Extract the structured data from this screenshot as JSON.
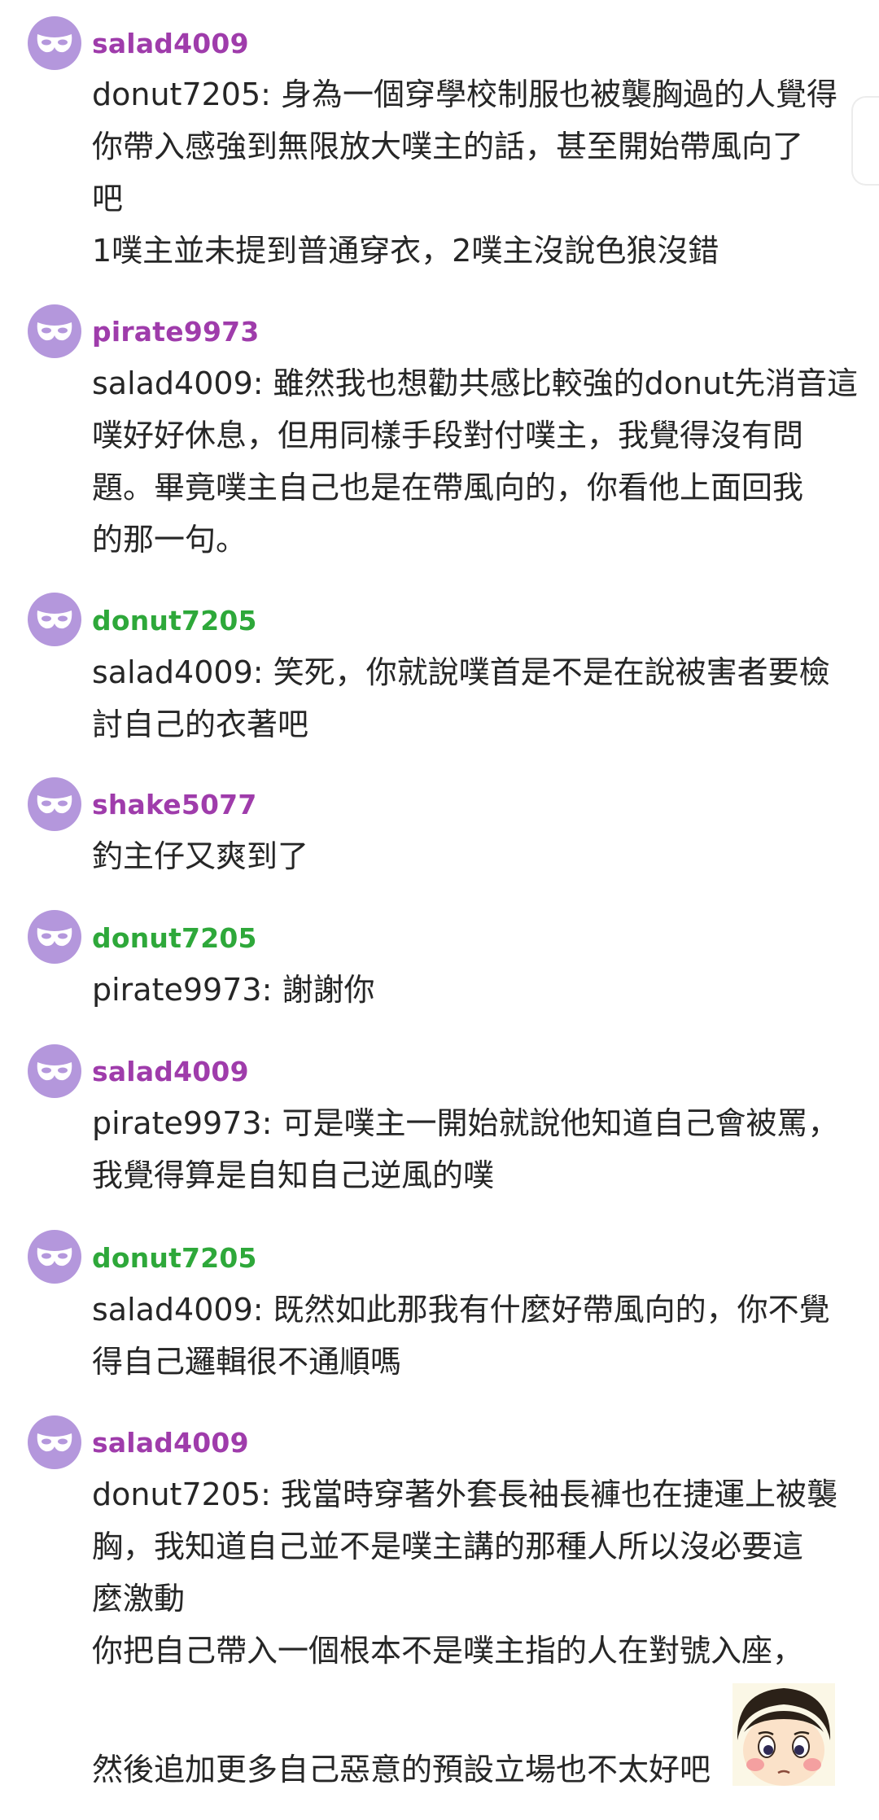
{
  "replies": [
    {
      "username": "salad4009",
      "lines": [
        "donut7205: 身為一個穿學校制服也被襲胸過的人覺得",
        "你帶入感強到無限放大噗主的話，甚至開始帶風向了",
        "吧",
        "1噗主並未提到普通穿衣，2噗主沒說色狼沒錯"
      ]
    },
    {
      "username": "pirate9973",
      "lines": [
        "salad4009: 雖然我也想勸共感比較強的donut先消音這",
        "噗好好休息，但用同樣手段對付噗主，我覺得沒有問",
        "題。畢竟噗主自己也是在帶風向的，你看他上面回我",
        "的那一句。"
      ]
    },
    {
      "username": "donut7205",
      "lines": [
        "salad4009: 笑死，你就說噗首是不是在說被害者要檢",
        "討自己的衣著吧"
      ]
    },
    {
      "username": "shake5077",
      "lines": [
        "釣主仔又爽到了"
      ]
    },
    {
      "username": "donut7205",
      "lines": [
        "pirate9973: 謝謝你"
      ]
    },
    {
      "username": "salad4009",
      "lines": [
        "pirate9973: 可是噗主一開始就說他知道自己會被罵，",
        "我覺得算是自知自己逆風的噗"
      ]
    },
    {
      "username": "donut7205",
      "lines": [
        "salad4009: 既然如此那我有什麼好帶風向的，你不覺",
        "得自己邏輯很不通順嗎"
      ]
    },
    {
      "username": "salad4009",
      "lines": [
        "donut7205: 我當時穿著外套長袖長褲也在捷運上被襲",
        "胸，我知道自己並不是噗主講的那種人所以沒必要這",
        "麼激動",
        "你把自己帶入一個根本不是噗主指的人在對號入座，",
        "",
        "然後追加更多自己惡意的預設立場也不太好吧"
      ]
    }
  ],
  "avatar_icon": "anonymous-mask-icon",
  "sticker_icon": "cartoon-girl-sticker",
  "colors": {
    "purple_user": "#9f3cab",
    "green_user": "#2ea83a",
    "avatar_bg": "#b497dc",
    "text": "#262626"
  }
}
